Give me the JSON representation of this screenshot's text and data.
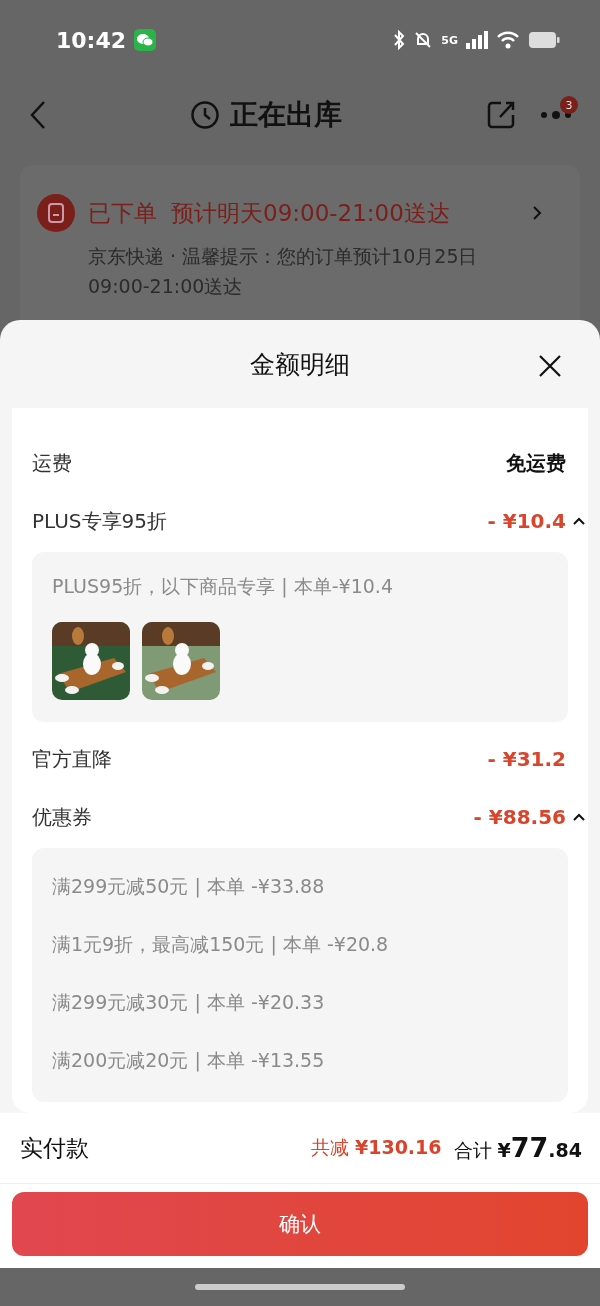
{
  "status_bar": {
    "time": "10:42",
    "network": "5G"
  },
  "nav": {
    "title": "正在出库",
    "badge": "3"
  },
  "order": {
    "status": "已下单",
    "eta": "预计明天09:00-21:00送达",
    "note": "京东快递 · 温馨提示：您的订单预计10月25日09:00-21:00送达"
  },
  "sheet": {
    "title": "金额明细",
    "rows": [
      {
        "label": "运费",
        "value": "免运费",
        "kind": "plain"
      },
      {
        "label": "PLUS专享95折",
        "value": "- ¥10.4",
        "kind": "discount",
        "expanded": true,
        "details": {
          "kind": "products",
          "text": "PLUS95折，以下商品专享 | 本单-¥10.4"
        }
      },
      {
        "label": "官方直降",
        "value": "- ¥31.2",
        "kind": "discount"
      },
      {
        "label": "优惠券",
        "value": "- ¥88.56",
        "kind": "discount",
        "expanded": true,
        "details": {
          "kind": "coupons",
          "lines": [
            "满299元减50元 | 本单 -¥33.88",
            "满1元9折，最高减150元 | 本单 -¥20.8",
            "满299元减30元 | 本单 -¥20.33",
            "满200元减20元 | 本单 -¥13.55"
          ]
        }
      }
    ]
  },
  "footer": {
    "label": "实付款",
    "saved_label": "共减",
    "saved": "¥130.16",
    "total_label": "合计",
    "total": "¥77.84"
  },
  "confirm_button": "确认"
}
